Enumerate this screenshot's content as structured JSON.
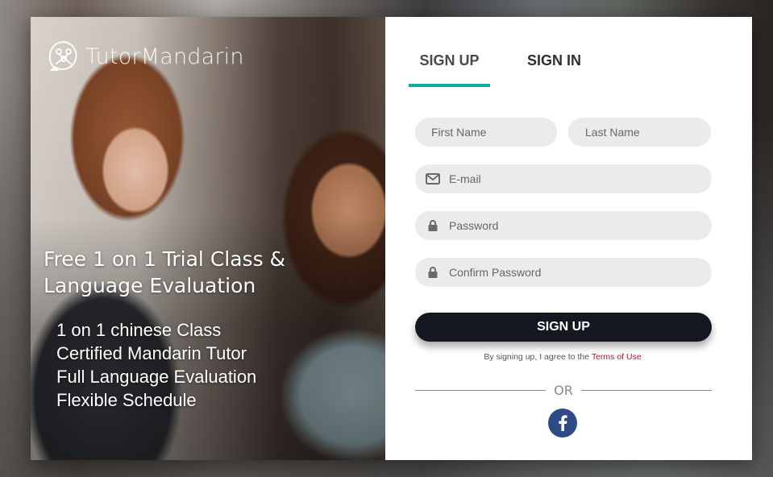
{
  "brand": {
    "name": "TutorMandarin",
    "logo_icon": "speech-bubble-knot-icon"
  },
  "hero": {
    "headline_line1": "Free 1 on 1 Trial Class &",
    "headline_line2": "Language Evaluation",
    "features": [
      "1 on 1 chinese Class",
      "Certified Mandarin Tutor",
      "Full Language Evaluation",
      "Flexible Schedule"
    ]
  },
  "tabs": [
    {
      "label": "SIGN UP",
      "active": true
    },
    {
      "label": "SIGN IN",
      "active": false
    }
  ],
  "form": {
    "first_name": {
      "placeholder": "First Name",
      "value": ""
    },
    "last_name": {
      "placeholder": "Last Name",
      "value": ""
    },
    "email": {
      "placeholder": "E-mail",
      "value": "",
      "icon": "envelope-icon"
    },
    "password": {
      "placeholder": "Password",
      "value": "",
      "icon": "lock-icon"
    },
    "confirm_password": {
      "placeholder": "Confirm Password",
      "value": "",
      "icon": "lock-icon"
    },
    "submit_label": "SIGN UP",
    "terms_prefix": "By signing up, I agree to the ",
    "terms_link": "Terms of Use",
    "or_label": "OR",
    "social": [
      {
        "name": "facebook",
        "icon": "facebook-icon"
      }
    ]
  },
  "colors": {
    "accent": "#19a89d",
    "button": "#161821",
    "terms_link": "#b5172a",
    "facebook": "#2e4b86",
    "field_bg": "#ebebeb"
  }
}
